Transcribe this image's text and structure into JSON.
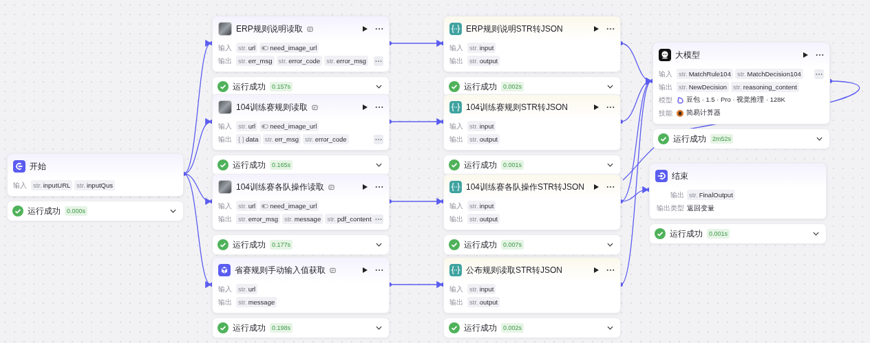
{
  "nodes": [
    {
      "kind": "start",
      "title": "开始",
      "rows": [
        {
          "label": "输入",
          "kind": "params",
          "params": [
            {
              "kind": "text",
              "type": "str.",
              "name": "inputURL"
            },
            {
              "kind": "text",
              "type": "str.",
              "name": "inputQus"
            }
          ]
        }
      ],
      "status": {
        "ok": true,
        "text": "运行成功",
        "time": "0.000s"
      }
    },
    {
      "kind": "plugin",
      "title": "ERP规则说明读取",
      "rows": [
        {
          "label": "输入",
          "kind": "params",
          "params": [
            {
              "kind": "text",
              "type": "str.",
              "name": "url"
            },
            {
              "kind": "toggle",
              "name": "need_image_url"
            }
          ]
        },
        {
          "label": "输出",
          "kind": "params",
          "more": true,
          "params": [
            {
              "kind": "text",
              "type": "str.",
              "name": "err_msg"
            },
            {
              "kind": "text",
              "type": "str.",
              "name": "error_code"
            },
            {
              "kind": "text",
              "type": "str.",
              "name": "error_msg"
            }
          ]
        }
      ],
      "status": {
        "ok": true,
        "text": "运行成功",
        "time": "0.157s"
      }
    },
    {
      "kind": "plugin",
      "title": "104训练赛规则读取",
      "rows": [
        {
          "label": "输入",
          "kind": "params",
          "params": [
            {
              "kind": "text",
              "type": "str.",
              "name": "url"
            },
            {
              "kind": "toggle",
              "name": "need_image_url"
            }
          ]
        },
        {
          "label": "输出",
          "kind": "params",
          "more": true,
          "params": [
            {
              "kind": "text",
              "type": "{ }",
              "name": "data"
            },
            {
              "kind": "text",
              "type": "str.",
              "name": "err_msg"
            },
            {
              "kind": "text",
              "type": "str.",
              "name": "error_code"
            }
          ]
        }
      ],
      "status": {
        "ok": true,
        "text": "运行成功",
        "time": "0.165s"
      }
    },
    {
      "kind": "plugin",
      "title": "104训练赛各队操作读取",
      "rows": [
        {
          "label": "输入",
          "kind": "params",
          "params": [
            {
              "kind": "text",
              "type": "str.",
              "name": "url"
            },
            {
              "kind": "toggle",
              "name": "need_image_url"
            }
          ]
        },
        {
          "label": "输出",
          "kind": "params",
          "more": true,
          "params": [
            {
              "kind": "text",
              "type": "str.",
              "name": "error_msg"
            },
            {
              "kind": "text",
              "type": "str.",
              "name": "message"
            },
            {
              "kind": "text",
              "type": "str.",
              "name": "pdf_content"
            }
          ]
        }
      ],
      "status": {
        "ok": true,
        "text": "运行成功",
        "time": "0.177s"
      }
    },
    {
      "kind": "component",
      "title": "省赛规则手动输入值获取",
      "rows": [
        {
          "label": "输入",
          "kind": "params",
          "params": [
            {
              "kind": "text",
              "type": "str.",
              "name": "url"
            }
          ]
        },
        {
          "label": "输出",
          "kind": "params",
          "params": [
            {
              "kind": "text",
              "type": "str.",
              "name": "message"
            }
          ]
        }
      ],
      "status": {
        "ok": true,
        "text": "运行成功",
        "time": "0.198s"
      }
    },
    {
      "kind": "code",
      "title": "ERP规则说明STR转JSON",
      "rows": [
        {
          "label": "输入",
          "kind": "params",
          "params": [
            {
              "kind": "text",
              "type": "str.",
              "name": "input"
            }
          ]
        },
        {
          "label": "输出",
          "kind": "params",
          "params": [
            {
              "kind": "text",
              "type": "str.",
              "name": "output"
            }
          ]
        }
      ],
      "status": {
        "ok": true,
        "text": "运行成功",
        "time": "0.002s"
      }
    },
    {
      "kind": "code",
      "title": "104训练赛规则STR转JSON",
      "rows": [
        {
          "label": "输入",
          "kind": "params",
          "params": [
            {
              "kind": "text",
              "type": "str.",
              "name": "input"
            }
          ]
        },
        {
          "label": "输出",
          "kind": "params",
          "params": [
            {
              "kind": "text",
              "type": "str.",
              "name": "output"
            }
          ]
        }
      ],
      "status": {
        "ok": true,
        "text": "运行成功",
        "time": "0.001s"
      }
    },
    {
      "kind": "code",
      "title": "104训练赛各队操作STR转JSON",
      "rows": [
        {
          "label": "输入",
          "kind": "params",
          "params": [
            {
              "kind": "text",
              "type": "str.",
              "name": "input"
            }
          ]
        },
        {
          "label": "输出",
          "kind": "params",
          "params": [
            {
              "kind": "text",
              "type": "str.",
              "name": "output"
            }
          ]
        }
      ],
      "status": {
        "ok": true,
        "text": "运行成功",
        "time": "0.007s"
      }
    },
    {
      "kind": "code",
      "title": "公布规则读取STR转JSON",
      "rows": [
        {
          "label": "输入",
          "kind": "params",
          "params": [
            {
              "kind": "text",
              "type": "str.",
              "name": "input"
            }
          ]
        },
        {
          "label": "输出",
          "kind": "params",
          "params": [
            {
              "kind": "text",
              "type": "str.",
              "name": "output"
            }
          ]
        }
      ],
      "status": {
        "ok": true,
        "text": "运行成功",
        "time": "0.002s"
      }
    },
    {
      "kind": "llm",
      "title": "大模型",
      "rows": [
        {
          "label": "输入",
          "kind": "params",
          "more": true,
          "params": [
            {
              "kind": "text",
              "type": "str.",
              "name": "MatchRule104"
            },
            {
              "kind": "text",
              "type": "str.",
              "name": "MatchDecision104"
            }
          ]
        },
        {
          "label": "输出",
          "kind": "params",
          "params": [
            {
              "kind": "text",
              "type": "str.",
              "name": "NewDecision"
            },
            {
              "kind": "text",
              "type": "str.",
              "name": "reasoning_content"
            }
          ]
        },
        {
          "label": "模型",
          "kind": "model",
          "text": "豆包 · 1.5 · Pro · 视觉推理 · 128K"
        },
        {
          "label": "技能",
          "kind": "skill",
          "text": "简易计算器"
        }
      ],
      "status": {
        "ok": true,
        "text": "运行成功",
        "time": "2m52s"
      }
    },
    {
      "kind": "end",
      "title": "结束",
      "rows": [
        {
          "label": "输出",
          "kind": "params",
          "params": [
            {
              "kind": "text",
              "type": "str.",
              "name": "FinalOutput"
            }
          ]
        },
        {
          "label": "输出类型",
          "kind": "text",
          "text": "返回变量"
        }
      ],
      "status": {
        "ok": true,
        "text": "运行成功",
        "time": "0.001s"
      }
    }
  ]
}
